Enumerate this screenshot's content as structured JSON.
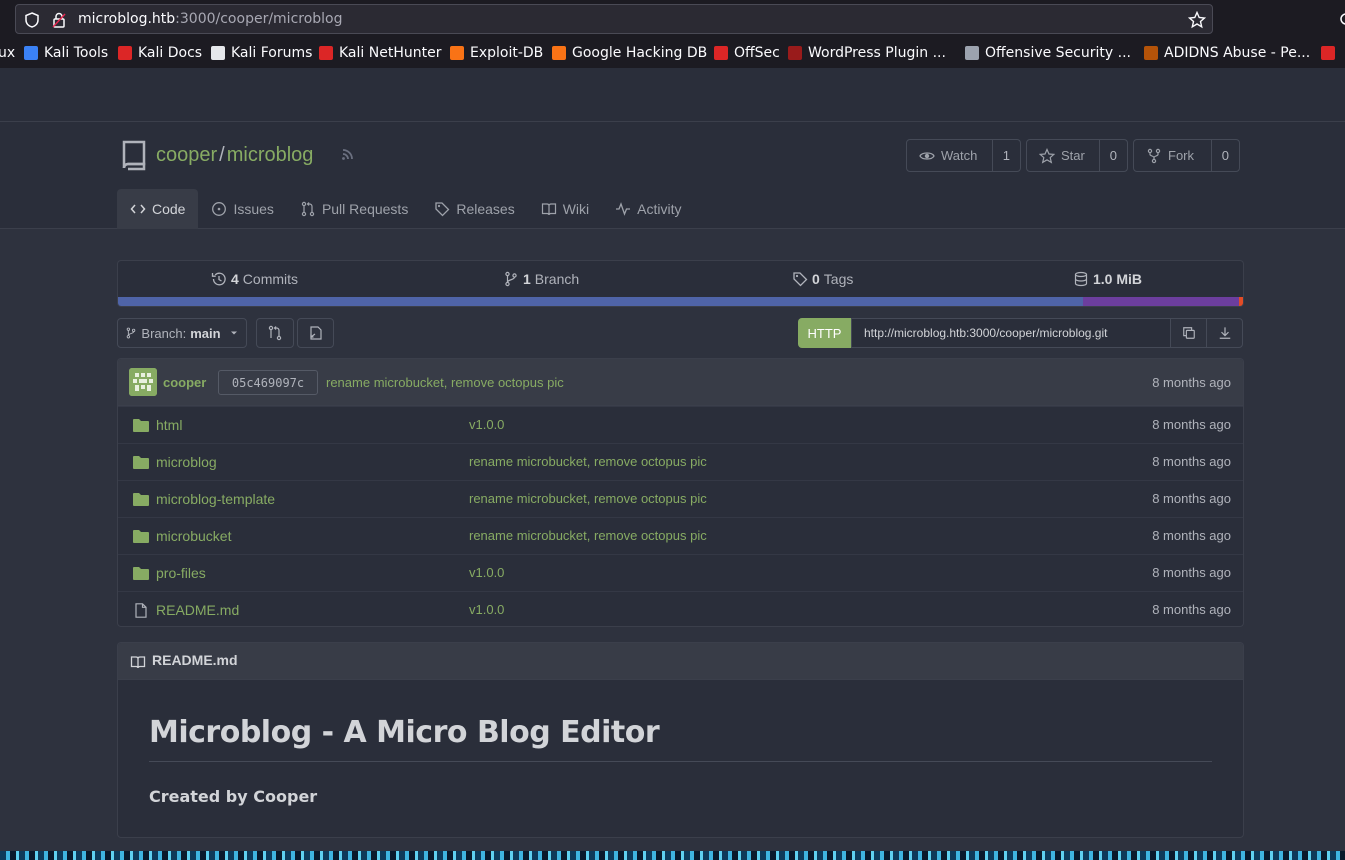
{
  "browser": {
    "url_host": "microblog.htb",
    "url_rest": ":3000/cooper/microblog",
    "bookmarks": [
      {
        "label": "ux",
        "color": "#1c1b22"
      },
      {
        "label": "Kali Tools",
        "color": "#3b82f6"
      },
      {
        "label": "Kali Docs",
        "color": "#dc2626"
      },
      {
        "label": "Kali Forums",
        "color": "#e5e7eb"
      },
      {
        "label": "Kali NetHunter",
        "color": "#dc2626"
      },
      {
        "label": "Exploit-DB",
        "color": "#f97316"
      },
      {
        "label": "Google Hacking DB",
        "color": "#f97316"
      },
      {
        "label": "OffSec",
        "color": "#dc2626"
      },
      {
        "label": "WordPress Plugin ...",
        "color": "#991b1b"
      },
      {
        "label": "Offensive Security ...",
        "color": "#9ca3af"
      },
      {
        "label": "ADIDNS Abuse - Pe...",
        "color": "#b45309"
      }
    ]
  },
  "repo": {
    "owner": "cooper",
    "name": "microblog",
    "watch_label": "Watch",
    "watch_count": "1",
    "star_label": "Star",
    "star_count": "0",
    "fork_label": "Fork",
    "fork_count": "0"
  },
  "tabs": [
    "Code",
    "Issues",
    "Pull Requests",
    "Releases",
    "Wiki",
    "Activity"
  ],
  "stats": {
    "commits_num": "4",
    "commits_label": "Commits",
    "branch_num": "1",
    "branch_label": "Branch",
    "tags_num": "0",
    "tags_label": "Tags",
    "size": "1.0 MiB"
  },
  "languages": [
    {
      "fraction": 0.858,
      "color": "#4f64a8"
    },
    {
      "fraction": 0.138,
      "color": "#6c3e9e"
    },
    {
      "fraction": 0.004,
      "color": "#e34c26"
    }
  ],
  "branch": {
    "label": "Branch:",
    "value": "main"
  },
  "clone": {
    "protocol": "HTTP",
    "url": "http://microblog.htb:3000/cooper/microblog.git"
  },
  "latest_commit": {
    "author": "cooper",
    "sha": "05c469097c",
    "message": "rename microbucket, remove octopus pic",
    "time": "8 months ago"
  },
  "files": [
    {
      "name": "html",
      "type": "folder",
      "message": "v1.0.0",
      "time": "8 months ago"
    },
    {
      "name": "microblog",
      "type": "folder",
      "message": "rename microbucket, remove octopus pic",
      "time": "8 months ago"
    },
    {
      "name": "microblog-template",
      "type": "folder",
      "message": "rename microbucket, remove octopus pic",
      "time": "8 months ago"
    },
    {
      "name": "microbucket",
      "type": "folder",
      "message": "rename microbucket, remove octopus pic",
      "time": "8 months ago"
    },
    {
      "name": "pro-files",
      "type": "folder",
      "message": "v1.0.0",
      "time": "8 months ago"
    },
    {
      "name": "README.md",
      "type": "file",
      "message": "v1.0.0",
      "time": "8 months ago"
    }
  ],
  "readme": {
    "filename": "README.md",
    "heading": "Microblog - A Micro Blog Editor",
    "body": "Created by Cooper"
  }
}
